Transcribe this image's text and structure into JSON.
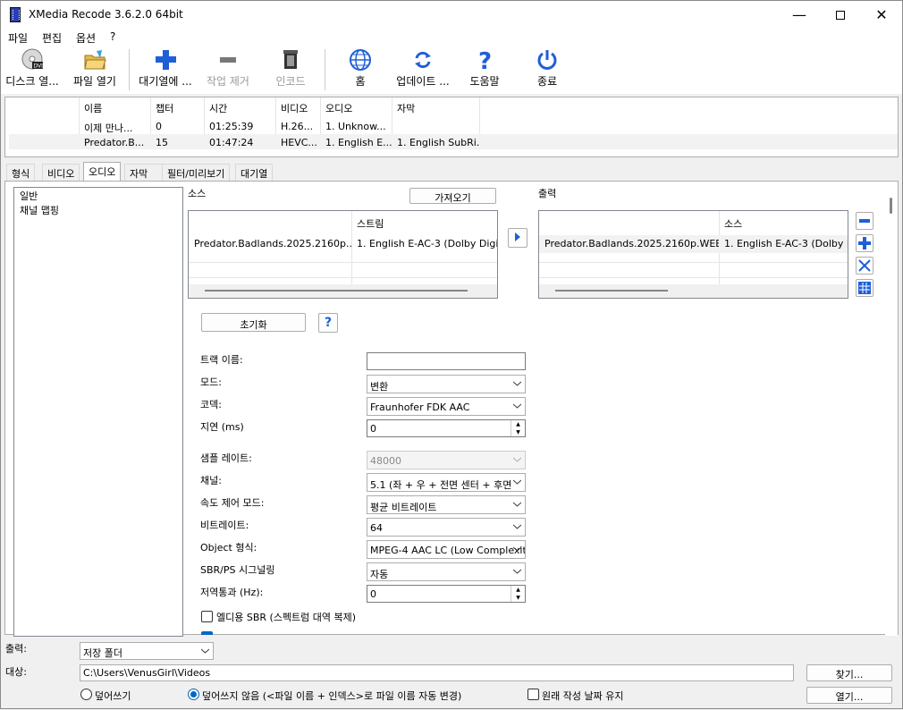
{
  "window": {
    "title": "XMedia Recode 3.6.2.0 64bit"
  },
  "menu": [
    "파일",
    "편집",
    "옵션",
    "?"
  ],
  "toolbar": {
    "disc_open": "디스크 열...",
    "file_open": "파일 열기",
    "add_queue": "대기열에 ...",
    "remove_job": "작업 제거",
    "encode": "인코드",
    "home": "홈",
    "update": "업데이트 ...",
    "help": "도움말",
    "exit": "종료"
  },
  "queue": {
    "headers": [
      "이름",
      "챕터",
      "시간",
      "비디오",
      "오디오",
      "자막"
    ],
    "rows": [
      [
        "이제 만나...",
        "0",
        "01:25:39",
        "H.26...",
        "1. Unknow...",
        ""
      ],
      [
        "Predator.B...",
        "15",
        "01:47:24",
        "HEVC...",
        "1. English E...",
        "1. English SubRi..."
      ]
    ]
  },
  "tabs": [
    "형식",
    "비디오",
    "오디오",
    "자막",
    "필터/미리보기",
    "대기열"
  ],
  "tree": [
    "일반",
    "채널 맵핑"
  ],
  "source": {
    "label": "소스",
    "import_btn": "가져오기",
    "col_stream": "스트림",
    "file": "Predator.Badlands.2025.2160p....",
    "stream": "1. English E-AC-3 (Dolby Digital ..."
  },
  "output": {
    "label": "출력",
    "col_source": "소스",
    "file": "Predator.Badlands.2025.2160p.WEB...",
    "source": "1. English E-AC-3 (Dolby Digi"
  },
  "settings": {
    "reset_btn": "초기화",
    "help_btn": "?",
    "track_name_label": "트랙 이름:",
    "track_name_value": "",
    "mode_label": "모드:",
    "mode_value": "변환",
    "codec_label": "코덱:",
    "codec_value": "Fraunhofer FDK AAC",
    "delay_label": "지연 (ms)",
    "delay_value": "0",
    "samplerate_label": "샘플 레이트:",
    "samplerate_value": "48000",
    "channels_label": "채널:",
    "channels_value": "5.1 (좌 + 우 + 전면 센터 + 후면",
    "ratecontrol_label": "속도 제어 모드:",
    "ratecontrol_value": "평균 비트레이트",
    "bitrate_label": "비트레이트:",
    "bitrate_value": "64",
    "object_label": "Object 형식:",
    "object_value": "MPEG-4 AAC LC (Low Complexity",
    "sbr_label": "SBR/PS 시그널링",
    "sbr_value": "자동",
    "lowpass_label": "저역통과 (Hz):",
    "lowpass_value": "0",
    "eld_sbr_label": "엘디용 SBR (스펙트럼 대역 복제)"
  },
  "bottom": {
    "output_label": "출력:",
    "output_value": "저장 폴더",
    "target_label": "대상:",
    "target_path": "C:\\Users\\VenusGirl\\Videos",
    "browse_btn": "찾기...",
    "open_btn": "열기...",
    "overwrite_label": "덮어쓰기",
    "no_overwrite_label": "덮어쓰지 않음 (<파일 이름 + 인덱스>로 파일 이름 자동 변경)",
    "keep_date_label": "원래 작성 날짜 유지"
  },
  "colors": {
    "accent": "#0067c0",
    "icon_blue": "#1e5fd8"
  }
}
